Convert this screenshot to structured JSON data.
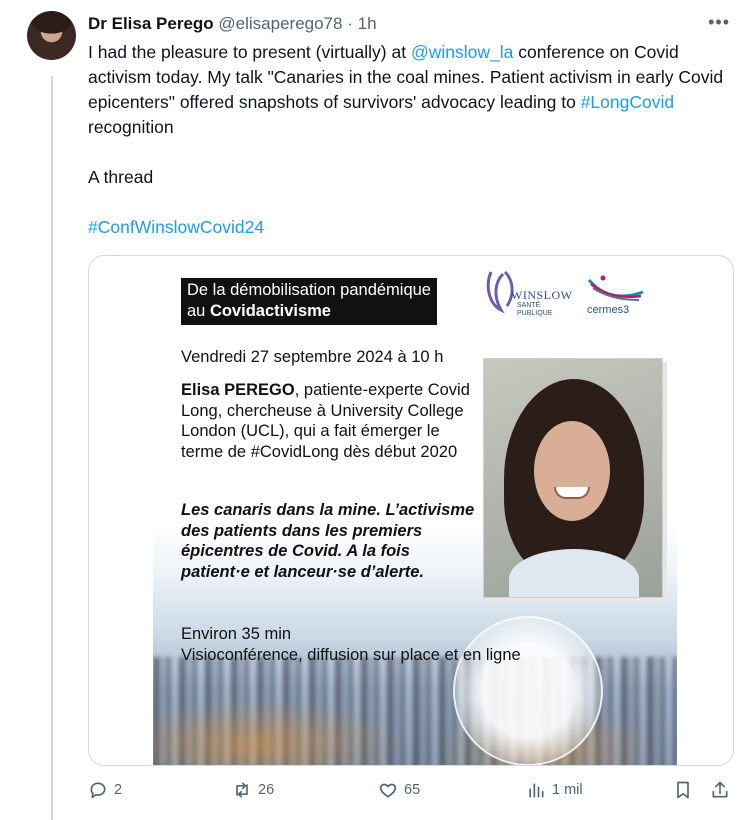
{
  "author": {
    "name": "Dr Elisa Perego",
    "handle": "@elisaperego78",
    "separator": "·",
    "time": "1h"
  },
  "tweet": {
    "line1_a": "I had the pleasure to present (virtually) at ",
    "mention": "@winslow_la",
    "line1_b": " conference on Covid activism today. My talk \"Canaries in the coal mines. Patient activism in early Covid epicenters\" offered snapshots of survivors' advocacy leading to ",
    "hashtag1": "#LongCovid",
    "line1_c": " recognition",
    "line2": "A thread",
    "hashtag2": "#ConfWinslowCovid24"
  },
  "poster": {
    "title_line1": "De la démobilisation pandémique",
    "title_line2_prefix": "au ",
    "title_line2_bold": "Covidactivisme",
    "logo_winslow": "WINSLOW",
    "logo_winslow_sub1": "SANTÉ",
    "logo_winslow_sub2": "PUBLIQUE",
    "logo_cermes": "cermes3",
    "date": "Vendredi 27 septembre 2024 à 10 h",
    "bio_name": "Elisa PEREGO",
    "bio_rest": ", patiente-experte Covid Long, chercheuse à University College London (UCL), qui a fait émerger le terme de #CovidLong dès début 2020",
    "talk": "Les canaris dans la mine. L’activisme des patients dans les premiers épicentres de Covid. A la fois patient·e et lanceur·se d’alerte.",
    "duration": "Environ 35 min",
    "format": "Visioconférence, diffusion sur place et en ligne"
  },
  "actions": {
    "replies": "2",
    "reposts": "26",
    "likes": "65",
    "views": "1 mil"
  },
  "colors": {
    "link": "#1d9bf0",
    "muted": "#536471",
    "text": "#0f1419"
  }
}
